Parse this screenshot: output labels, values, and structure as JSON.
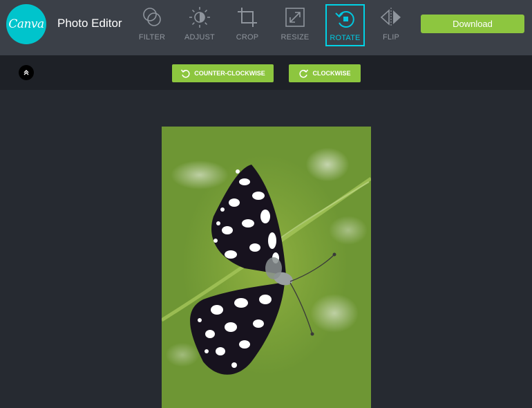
{
  "header": {
    "logo_text": "Canva",
    "app_title": "Photo Editor",
    "download_label": "Download"
  },
  "tools": [
    {
      "id": "filter",
      "label": "FILTER",
      "icon": "filter-icon"
    },
    {
      "id": "adjust",
      "label": "ADJUST",
      "icon": "adjust-icon"
    },
    {
      "id": "crop",
      "label": "CROP",
      "icon": "crop-icon"
    },
    {
      "id": "resize",
      "label": "RESIZE",
      "icon": "resize-icon"
    },
    {
      "id": "rotate",
      "label": "ROTATE",
      "icon": "rotate-icon",
      "active": true
    },
    {
      "id": "flip",
      "label": "FLIP",
      "icon": "flip-icon"
    }
  ],
  "rotate_options": {
    "counter_clockwise_label": "COUNTER-CLOCKWISE",
    "clockwise_label": "CLOCKWISE"
  },
  "colors": {
    "accent_green": "#8dc63f",
    "active_cyan": "#00d3e6",
    "brand_teal": "#00c4cc",
    "topbar": "#3b4048",
    "subbar": "#1e2127",
    "workspace": "#262a31"
  },
  "canvas": {
    "image_subject": "butterfly-photo"
  }
}
